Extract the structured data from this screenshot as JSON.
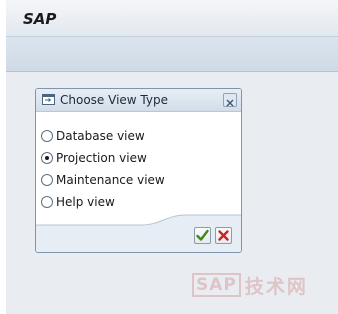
{
  "app": {
    "title": "SAP"
  },
  "dialog": {
    "title": "Choose View Type",
    "options": [
      {
        "label": "Database view",
        "selected": false
      },
      {
        "label": "Projection view",
        "selected": true
      },
      {
        "label": "Maintenance view",
        "selected": false
      },
      {
        "label": "Help view",
        "selected": false
      }
    ],
    "icons": {
      "title": "dialog-window-icon",
      "close": "close-icon",
      "ok": "checkmark-icon",
      "cancel": "cancel-x-icon"
    }
  },
  "watermark": {
    "logo": "SAP",
    "text": "技术网"
  },
  "colors": {
    "accept": "#3a8a1c",
    "cancel": "#cc2222",
    "accent": "#7e95ad"
  }
}
